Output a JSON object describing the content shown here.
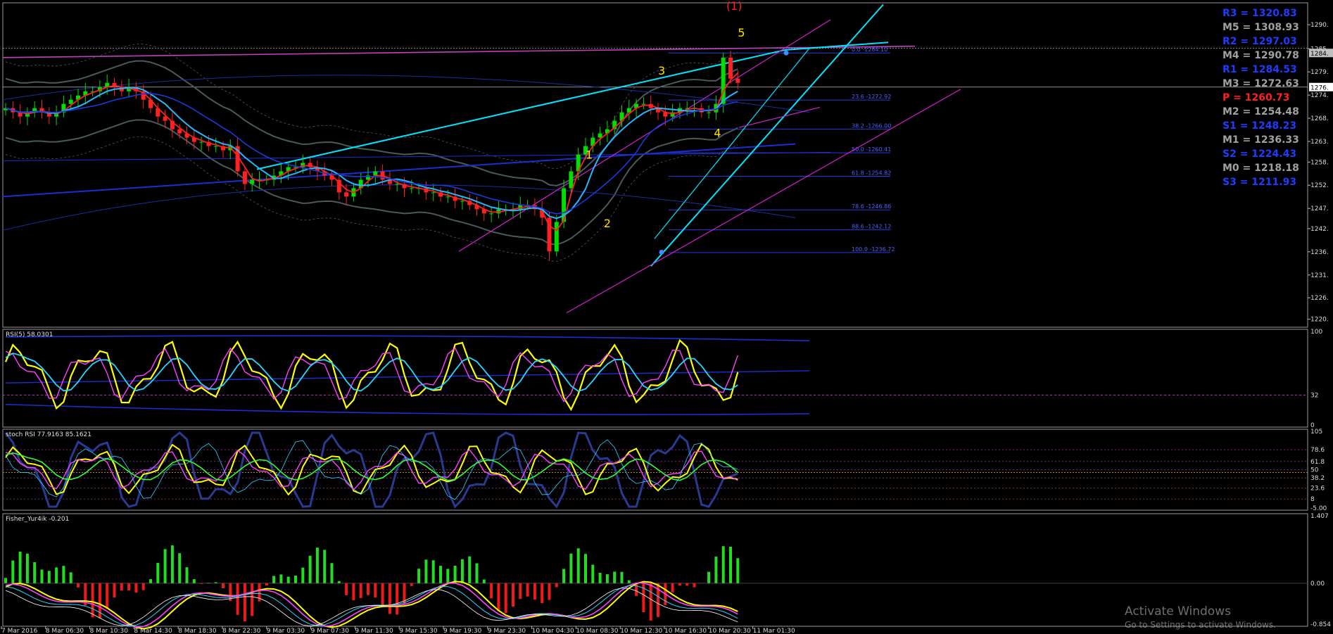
{
  "chart_data": {
    "type": "line",
    "symbol_note": "",
    "price_axis": {
      "ticks": [
        1290.8,
        1285.1,
        1279.6,
        1274.1,
        1268.6,
        1263.1,
        1258.2,
        1252.7,
        1247.2,
        1242.4,
        1236.9,
        1231.4,
        1226.0,
        1220.9
      ],
      "tick_labels": [
        "1290.",
        "1285.",
        "1279.",
        "1274.",
        "1268.",
        "1263.",
        "1258.",
        "1252.",
        "1247.",
        "1242.",
        "1236.",
        "1231.",
        "1226.",
        "1220."
      ],
      "current_labels": [
        "1284.",
        "1276."
      ],
      "ylim": [
        1219.0,
        1296.0
      ]
    },
    "time_labels": [
      "7 Mar 2016",
      "8 Mar 06:30",
      "8 Mar 10:30",
      "8 Mar 14:30",
      "8 Mar 18:30",
      "8 Mar 22:30",
      "9 Mar 03:30",
      "9 Mar 07:30",
      "9 Mar 11:30",
      "9 Mar 15:30",
      "9 Mar 19:30",
      "9 Mar 23:30",
      "10 Mar 04:30",
      "10 Mar 08:30",
      "10 Mar 12:30",
      "10 Mar 16:30",
      "10 Mar 20:30",
      "11 Mar 01:30"
    ],
    "pivots": [
      {
        "label": "R3 = 1320.83",
        "color": "#1e3cff"
      },
      {
        "label": "M5 = 1308.93",
        "color": "#a0a0a0"
      },
      {
        "label": "R2 = 1297.03",
        "color": "#1e3cff"
      },
      {
        "label": "M4 = 1290.78",
        "color": "#a0a0a0"
      },
      {
        "label": "R1 = 1284.53",
        "color": "#1e3cff"
      },
      {
        "label": "M3 = 1272.63",
        "color": "#a0a0a0"
      },
      {
        "label": "P   = 1260.73",
        "color": "#ff2020"
      },
      {
        "label": "M2 = 1254.48",
        "color": "#a0a0a0"
      },
      {
        "label": "S1 = 1248.23",
        "color": "#1e3cff"
      },
      {
        "label": "M1 = 1236.33",
        "color": "#a0a0a0"
      },
      {
        "label": "S2 = 1224.43",
        "color": "#1e3cff"
      },
      {
        "label": "M0 = 1218.18",
        "color": "#a0a0a0"
      },
      {
        "label": "S3 = 1211.93",
        "color": "#1e3cff"
      }
    ],
    "fibonacci": [
      {
        "label": "0.0 -1284.10",
        "price": 1284.1
      },
      {
        "label": "23.6 -1272.92",
        "price": 1272.92
      },
      {
        "label": "38.2 -1266.00",
        "price": 1266.0
      },
      {
        "label": "50.0 -1260.41",
        "price": 1260.41
      },
      {
        "label": "61.8 -1254.82",
        "price": 1254.82
      },
      {
        "label": "78.6 -1246.86",
        "price": 1246.86
      },
      {
        "label": "88.6 -1242.12",
        "price": 1242.12
      },
      {
        "label": "100.0 -1236.72",
        "price": 1236.72
      }
    ],
    "wave_labels": [
      {
        "text": "(1)",
        "color": "#ff2020",
        "price": 1294.3,
        "bar": 100.5
      },
      {
        "text": "5",
        "color": "#ffe000",
        "price": 1288.0,
        "bar": 101.5
      },
      {
        "text": "3",
        "color": "#ffe000",
        "price": 1279.0,
        "bar": 90.5
      },
      {
        "text": "4",
        "color": "#ffe000",
        "price": 1264.2,
        "bar": 98.2
      },
      {
        "text": "1",
        "color": "#ffe000",
        "price": 1259.0,
        "bar": 80.5
      },
      {
        "text": "2",
        "color": "#ffe000",
        "price": 1242.7,
        "bar": 83.0
      }
    ],
    "close_series": [
      1271,
      1270,
      1269,
      1270,
      1271,
      1270,
      1269,
      1270,
      1272,
      1273,
      1274,
      1275,
      1275,
      1276,
      1277,
      1276,
      1275,
      1276,
      1275,
      1273,
      1271,
      1269,
      1268,
      1266,
      1265,
      1264,
      1263,
      1263,
      1262,
      1262,
      1261,
      1262,
      1256,
      1253,
      1254,
      1254,
      1254,
      1255,
      1256,
      1257,
      1257,
      1258,
      1257,
      1256,
      1255,
      1254,
      1251,
      1250,
      1252,
      1254,
      1255,
      1256,
      1254,
      1253,
      1253,
      1252,
      1252,
      1252,
      1251,
      1251,
      1250,
      1250,
      1249,
      1249,
      1248,
      1247,
      1246,
      1246,
      1247,
      1247,
      1247,
      1248,
      1248,
      1247,
      1245,
      1237,
      1244,
      1252,
      1256,
      1260,
      1262,
      1264,
      1265,
      1266,
      1268,
      1270,
      1271,
      1272,
      1272,
      1271,
      1270,
      1269,
      1270,
      1271,
      1271,
      1271,
      1270,
      1270,
      1272,
      1283,
      1278,
      1277
    ],
    "indicators": [
      {
        "name": "RSI(5) 58.0301",
        "levels": [
          "100",
          "32",
          "0"
        ]
      },
      {
        "name": "stoch RSI 77.9163 85.1621",
        "levels": [
          "105",
          "78.6",
          "61.8",
          "50",
          "38.2",
          "23.6",
          "8",
          "-5.00"
        ]
      },
      {
        "name": "Fisher_Yur4ik -0.201",
        "levels": [
          "1.407",
          "0.00",
          "-0.854"
        ]
      }
    ]
  },
  "watermark": {
    "line1": "Activate Windows",
    "line2": "Go to Settings to activate Windows."
  },
  "colors": {
    "bull": "#00dd00",
    "bear": "#ff2020",
    "trend": "#00e5ff",
    "channel": "#d020d0",
    "pivot_line": "#c040c0"
  }
}
